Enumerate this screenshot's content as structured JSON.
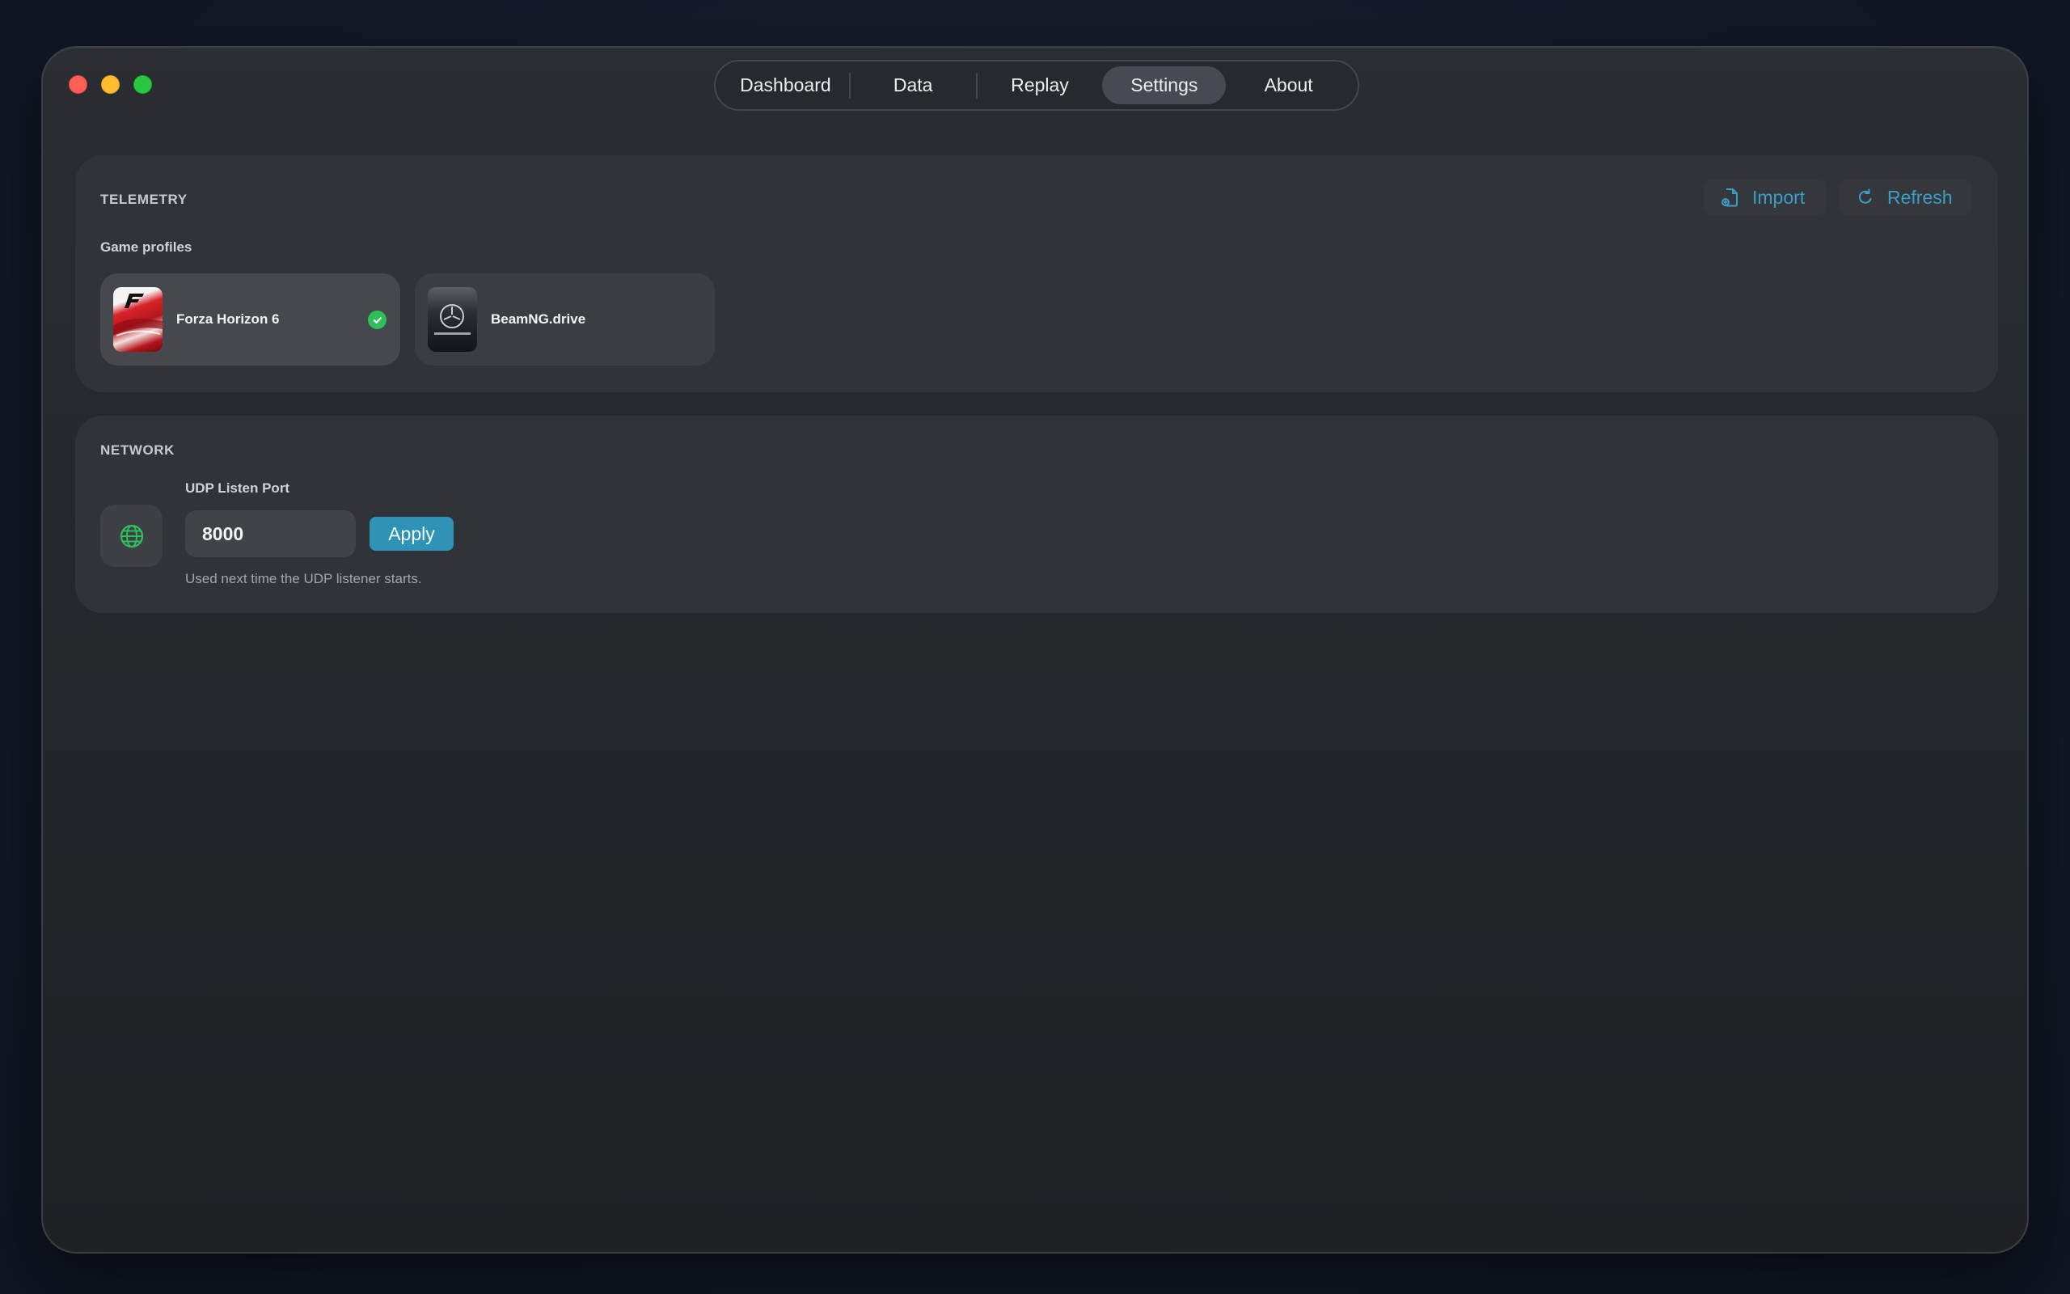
{
  "tabs": [
    {
      "label": "Dashboard",
      "active": false
    },
    {
      "label": "Data",
      "active": false
    },
    {
      "label": "Replay",
      "active": false
    },
    {
      "label": "Settings",
      "active": true
    },
    {
      "label": "About",
      "active": false
    }
  ],
  "telemetry": {
    "title": "TELEMETRY",
    "import_label": "Import",
    "refresh_label": "Refresh",
    "profiles_label": "Game profiles",
    "profiles": [
      {
        "name": "Forza Horizon 6",
        "selected": true,
        "icon": "forza-cover"
      },
      {
        "name": "BeamNG.drive",
        "selected": false,
        "icon": "beamng-cover"
      }
    ]
  },
  "network": {
    "title": "NETWORK",
    "port_label": "UDP Listen Port",
    "port_value": "8000",
    "apply_label": "Apply",
    "hint": "Used next time the UDP listener starts.",
    "icon": "globe-icon"
  },
  "colors": {
    "accent": "#3b9ec6",
    "apply_bg": "#2f93b8",
    "success": "#2fbf5a",
    "globe": "#2fbf5a"
  }
}
